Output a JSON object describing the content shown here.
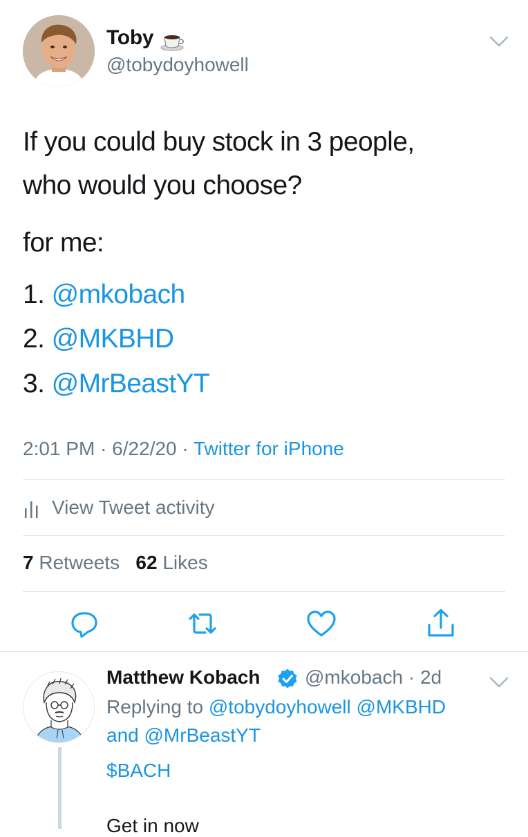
{
  "tweet": {
    "author_name": "Toby",
    "author_emoji": "☕",
    "author_handle": "@tobydoyhowell",
    "text_line1": "If you could buy stock in 3 people,",
    "text_line2": "who would you choose?",
    "text_line3": "for me:",
    "items": [
      {
        "number": "1.",
        "mention": "@mkobach"
      },
      {
        "number": "2.",
        "mention": "@MKBHD"
      },
      {
        "number": "3.",
        "mention": "@MrBeastYT"
      }
    ],
    "time": "2:01 PM",
    "date": "6/22/20",
    "source": "Twitter for iPhone"
  },
  "activity": {
    "label": "View Tweet activity"
  },
  "stats": {
    "retweets_count": "7",
    "retweets_label": "Retweets",
    "likes_count": "62",
    "likes_label": "Likes"
  },
  "actions": {
    "reply_icon": "reply-icon",
    "retweet_icon": "retweet-icon",
    "like_icon": "heart-icon",
    "share_icon": "share-icon"
  },
  "reply": {
    "author_name": "Matthew Kobach",
    "author_handle": "@mkobach",
    "age": "2d",
    "replying_prefix": "Replying to",
    "replying_to_1": "@tobydoyhowell",
    "replying_to_2": "@MKBHD",
    "replying_and": "and",
    "replying_to_3": "@MrBeastYT",
    "ticker": "$BACH",
    "text": "Get in now"
  },
  "colors": {
    "link": "#1b95e0",
    "secondary_text": "#657786",
    "divider": "#e1e8ed"
  }
}
